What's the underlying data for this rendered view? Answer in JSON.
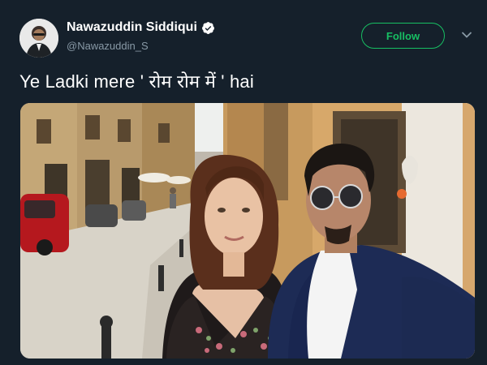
{
  "tweet": {
    "author": {
      "display_name": "Nawazuddin Siddiqui",
      "handle": "@Nawazuddin_S",
      "verified": true,
      "avatar_icon": "avatar-photo",
      "verified_icon": "verified-badge-icon"
    },
    "follow_label": "Follow",
    "more_icon": "chevron-down-icon",
    "text": "Ye Ladki mere ' रोम रोम में ' hai",
    "media": {
      "type": "photo",
      "description_icon": "selfie-photo"
    }
  },
  "colors": {
    "background": "#15202b",
    "follow_green": "#17bf63",
    "secondary_text": "#8899a6",
    "verified_white": "#ffffff"
  }
}
